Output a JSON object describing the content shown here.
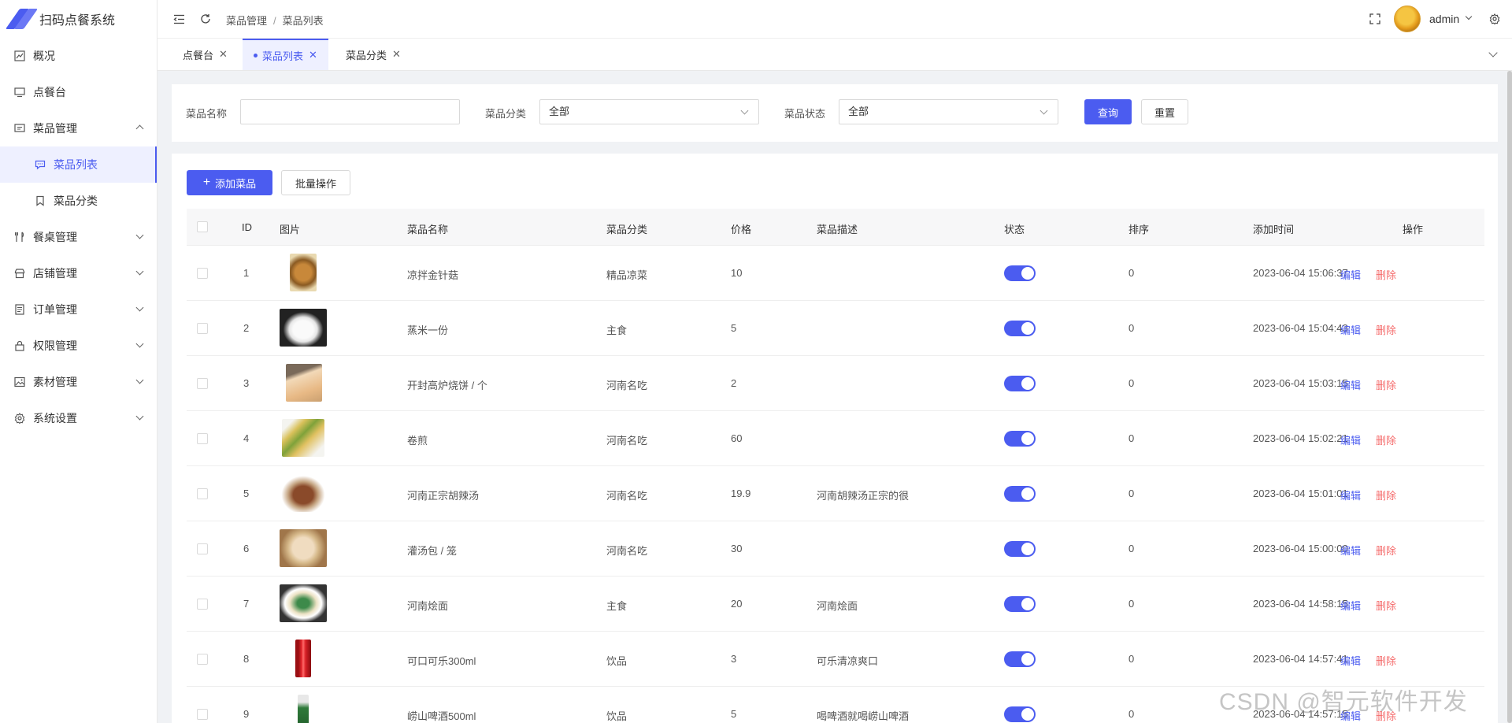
{
  "app": {
    "title": "扫码点餐系统"
  },
  "sidebar": {
    "items": [
      {
        "label": "概况",
        "icon": "chart-icon"
      },
      {
        "label": "点餐台",
        "icon": "monitor-icon"
      },
      {
        "label": "菜品管理",
        "icon": "message-icon",
        "expanded": true
      },
      {
        "label": "菜品列表",
        "icon": "chat-icon",
        "active": true
      },
      {
        "label": "菜品分类",
        "icon": "bookmark-icon"
      },
      {
        "label": "餐桌管理",
        "icon": "utensils-icon"
      },
      {
        "label": "店铺管理",
        "icon": "store-icon"
      },
      {
        "label": "订单管理",
        "icon": "document-icon"
      },
      {
        "label": "权限管理",
        "icon": "lock-icon"
      },
      {
        "label": "素材管理",
        "icon": "image-icon"
      },
      {
        "label": "系统设置",
        "icon": "gear-icon"
      }
    ]
  },
  "header": {
    "breadcrumb": [
      "菜品管理",
      "菜品列表"
    ],
    "username": "admin"
  },
  "tabs": [
    {
      "label": "点餐台"
    },
    {
      "label": "菜品列表",
      "active": true
    },
    {
      "label": "菜品分类"
    }
  ],
  "filter": {
    "name_label": "菜品名称",
    "name_value": "",
    "category_label": "菜品分类",
    "category_value": "全部",
    "status_label": "菜品状态",
    "status_value": "全部",
    "query_label": "查询",
    "reset_label": "重置"
  },
  "toolbar": {
    "add_label": "添加菜品",
    "batch_label": "批量操作"
  },
  "table": {
    "columns": [
      "ID",
      "图片",
      "菜品名称",
      "菜品分类",
      "价格",
      "菜品描述",
      "状态",
      "排序",
      "添加时间",
      "操作"
    ],
    "edit_label": "编辑",
    "delete_label": "删除",
    "rows": [
      {
        "id": "1",
        "name": "凉拌金针菇",
        "category": "精品凉菜",
        "price": "10",
        "desc": "",
        "status": true,
        "sort": "0",
        "time": "2023-06-04 15:06:37",
        "img": "salad"
      },
      {
        "id": "2",
        "name": "蒸米一份",
        "category": "主食",
        "price": "5",
        "desc": "",
        "status": true,
        "sort": "0",
        "time": "2023-06-04 15:04:43",
        "img": "rice"
      },
      {
        "id": "3",
        "name": "开封高炉烧饼 / 个",
        "category": "河南名吃",
        "price": "2",
        "desc": "",
        "status": true,
        "sort": "0",
        "time": "2023-06-04 15:03:15",
        "img": "bread"
      },
      {
        "id": "4",
        "name": "卷煎",
        "category": "河南名吃",
        "price": "60",
        "desc": "",
        "status": true,
        "sort": "0",
        "time": "2023-06-04 15:02:21",
        "img": "roll"
      },
      {
        "id": "5",
        "name": "河南正宗胡辣汤",
        "category": "河南名吃",
        "price": "19.9",
        "desc": "河南胡辣汤正宗的很",
        "status": true,
        "sort": "0",
        "time": "2023-06-04 15:01:01",
        "img": "soup"
      },
      {
        "id": "6",
        "name": "灌汤包 / 笼",
        "category": "河南名吃",
        "price": "30",
        "desc": "",
        "status": true,
        "sort": "0",
        "time": "2023-06-04 15:00:00",
        "img": "buns"
      },
      {
        "id": "7",
        "name": "河南烩面",
        "category": "主食",
        "price": "20",
        "desc": "河南烩面",
        "status": true,
        "sort": "0",
        "time": "2023-06-04 14:58:15",
        "img": "noodles"
      },
      {
        "id": "8",
        "name": "可口可乐300ml",
        "category": "饮品",
        "price": "3",
        "desc": "可乐清凉爽口",
        "status": true,
        "sort": "0",
        "time": "2023-06-04 14:57:41",
        "img": "cola"
      },
      {
        "id": "9",
        "name": "崂山啤酒500ml",
        "category": "饮品",
        "price": "5",
        "desc": "喝啤酒就喝崂山啤酒",
        "status": true,
        "sort": "0",
        "time": "2023-06-04 14:57:15",
        "img": "beer"
      }
    ]
  },
  "watermark": "CSDN @智元软件开发",
  "colors": {
    "primary": "#4b5cf0",
    "danger": "#f56c6c",
    "active_bg": "#eef0ff"
  }
}
